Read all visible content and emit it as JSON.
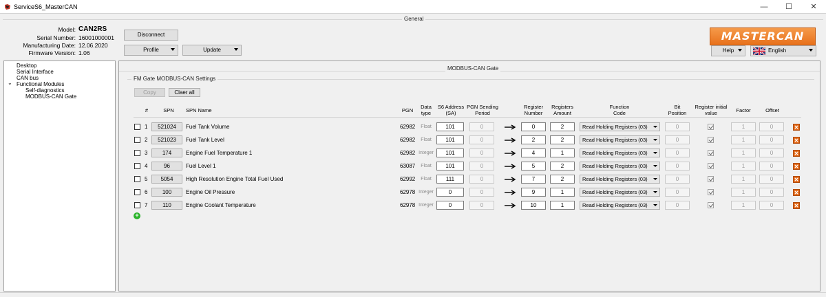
{
  "window": {
    "title": "ServiceS6_MasterCAN",
    "minimize": "—",
    "maximize": "☐",
    "close": "✕"
  },
  "general": {
    "group_label": "General",
    "model_label": "Model:",
    "model_value": "CAN2RS",
    "serial_label": "Serial Number:",
    "serial_value": "16001000001",
    "mfg_label": "Manufacturing Date:",
    "mfg_value": "12.06.2020",
    "fw_label": "Firmware Version:",
    "fw_value": "1.06",
    "disconnect": "Disconnect",
    "profile": "Profile",
    "update": "Update",
    "help": "Help",
    "language": "English",
    "logo": "MASTERCAN",
    "brand_color": "#e8711b"
  },
  "tree": [
    {
      "label": "Desktop",
      "indent": 0
    },
    {
      "label": "Serial Interface",
      "indent": 0
    },
    {
      "label": "CAN bus",
      "indent": 0
    },
    {
      "label": "Functional Modules",
      "indent": 0,
      "expander": "⌄"
    },
    {
      "label": "Self-diagnostics",
      "indent": 1
    },
    {
      "label": "MODBUS-CAN Gate",
      "indent": 1
    }
  ],
  "main": {
    "title": "MODBUS-CAN Gate",
    "group_label": "FM Gate MODBUS-CAN Settings",
    "copy": "Copy",
    "clear_all": "Claer all",
    "columns": {
      "num": "#",
      "spn": "SPN",
      "spn_name": "SPN Name",
      "pgn": "PGN",
      "dtype_1": "Data",
      "dtype_2": "type",
      "sa_1": "S6 Address",
      "sa_2": "(SA)",
      "period_1": "PGN Sending",
      "period_2": "Period",
      "reg_1": "Register",
      "reg_2": "Number",
      "amt_1": "Registers",
      "amt_2": "Amount",
      "fc_1": "Function",
      "fc_2": "Code",
      "bit_1": "Bit",
      "bit_2": "Position",
      "init_1": "Register initial",
      "init_2": "value",
      "factor": "Factor",
      "offset": "Offset"
    },
    "rows": [
      {
        "num": "1",
        "spn": "521024",
        "name": "Fuel Tank Volume",
        "pgn": "62982",
        "dtype": "Float",
        "sa": "101",
        "period": "0",
        "reg": "0",
        "amt": "2",
        "fc": "Read Holding Registers (03)",
        "bit": "0",
        "factor": "1",
        "offset": "0"
      },
      {
        "num": "2",
        "spn": "521023",
        "name": "Fuel Tank Level",
        "pgn": "62982",
        "dtype": "Float",
        "sa": "101",
        "period": "0",
        "reg": "2",
        "amt": "2",
        "fc": "Read Holding Registers (03)",
        "bit": "0",
        "factor": "1",
        "offset": "0"
      },
      {
        "num": "3",
        "spn": "174",
        "name": "Engine Fuel Temperature 1",
        "pgn": "62982",
        "dtype": "Integer",
        "sa": "101",
        "period": "0",
        "reg": "4",
        "amt": "1",
        "fc": "Read Holding Registers (03)",
        "bit": "0",
        "factor": "1",
        "offset": "0"
      },
      {
        "num": "4",
        "spn": "96",
        "name": "Fuel Level 1",
        "pgn": "63087",
        "dtype": "Float",
        "sa": "101",
        "period": "0",
        "reg": "5",
        "amt": "2",
        "fc": "Read Holding Registers (03)",
        "bit": "0",
        "factor": "1",
        "offset": "0"
      },
      {
        "num": "5",
        "spn": "5054",
        "name": "High Resolution Engine Total Fuel Used",
        "pgn": "62992",
        "dtype": "Float",
        "sa": "111",
        "period": "0",
        "reg": "7",
        "amt": "2",
        "fc": "Read Holding Registers (03)",
        "bit": "0",
        "factor": "1",
        "offset": "0"
      },
      {
        "num": "6",
        "spn": "100",
        "name": "Engine Oil Pressure",
        "pgn": "62978",
        "dtype": "Integer",
        "sa": "0",
        "period": "0",
        "reg": "9",
        "amt": "1",
        "fc": "Read Holding Registers (03)",
        "bit": "0",
        "factor": "1",
        "offset": "0"
      },
      {
        "num": "7",
        "spn": "110",
        "name": "Engine Coolant Temperature",
        "pgn": "62978",
        "dtype": "Integer",
        "sa": "0",
        "period": "0",
        "reg": "10",
        "amt": "1",
        "fc": "Read Holding Registers (03)",
        "bit": "0",
        "factor": "1",
        "offset": "0"
      }
    ],
    "add_icon": "+",
    "delete_icon": "✕"
  }
}
